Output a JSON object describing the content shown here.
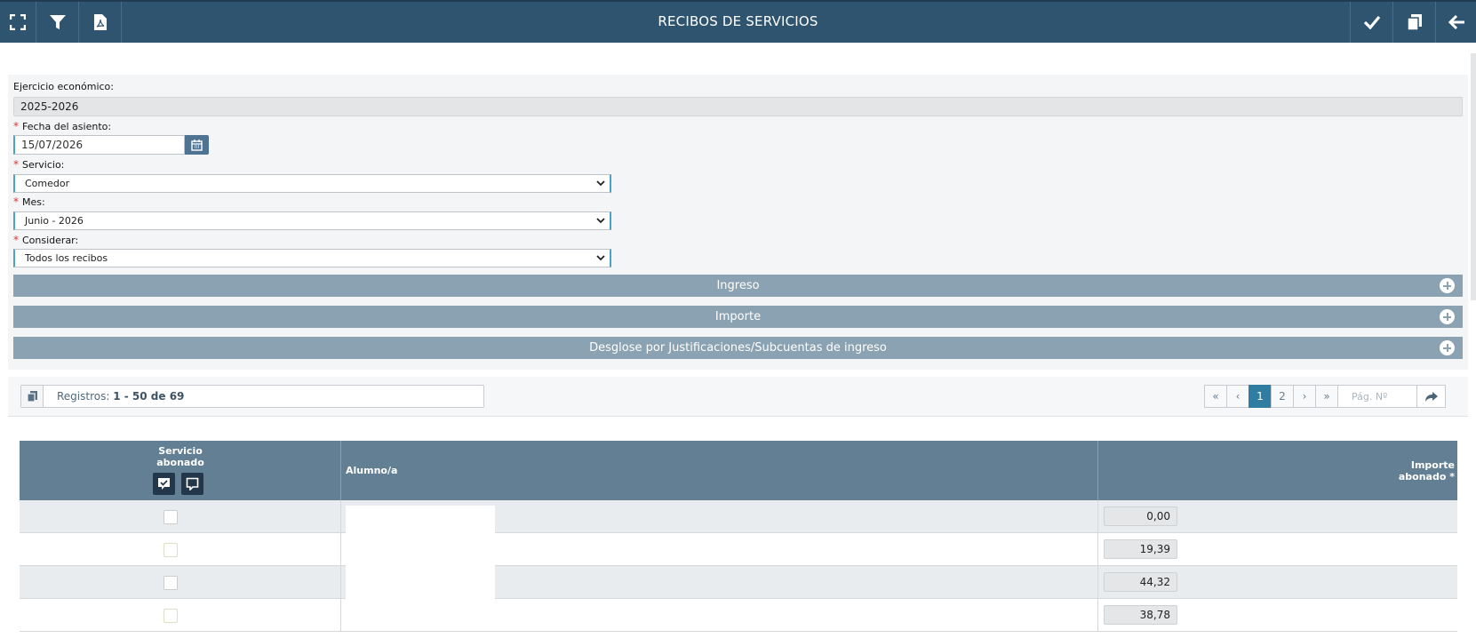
{
  "topbar": {
    "title": "RECIBOS DE SERVICIOS",
    "left_buttons": [
      "fullscreen-icon",
      "filter-icon",
      "pdf-icon"
    ],
    "right_buttons": [
      "checkmark-icon",
      "copy-icon",
      "back-arrow-icon"
    ]
  },
  "form": {
    "ejercicio": {
      "label": "Ejercicio económico:",
      "value": "2025-2026"
    },
    "fecha": {
      "label": "Fecha del asiento:",
      "value": "15/07/2026",
      "required": true
    },
    "servicio": {
      "label": "Servicio:",
      "value": "Comedor",
      "required": true
    },
    "mes": {
      "label": "Mes:",
      "value": "Junio - 2026",
      "required": true
    },
    "considerar": {
      "label": "Considerar:",
      "value": "Todos los recibos",
      "required": true
    },
    "required_mark": "*"
  },
  "accordions": [
    {
      "label": "Ingreso"
    },
    {
      "label": "Importe"
    },
    {
      "label": "Desglose por Justificaciones/Subcuentas de ingreso"
    }
  ],
  "records": {
    "prefix": "Registros:",
    "range": "1 - 50 de 69"
  },
  "pager": {
    "first": "«",
    "prev": "‹",
    "pages": [
      "1",
      "2"
    ],
    "current_page": "1",
    "next": "›",
    "last": "»",
    "page_placeholder": "Pág. Nº"
  },
  "table": {
    "headers": {
      "servicio_line1": "Servicio",
      "servicio_line2": "abonado",
      "alumno": "Alumno/a",
      "importe_line1": "Importe",
      "importe_line2": "abonado *"
    },
    "rows": [
      {
        "checked": false,
        "amount": "0,00"
      },
      {
        "checked": false,
        "amount": "19,39"
      },
      {
        "checked": false,
        "amount": "44,32"
      },
      {
        "checked": false,
        "amount": "38,78"
      }
    ]
  },
  "colors": {
    "topbar": "#2e5470",
    "accordion": "#8ba2b2",
    "table_header": "#627f93",
    "active_page": "#2f7ea2",
    "required": "#dd3333"
  }
}
